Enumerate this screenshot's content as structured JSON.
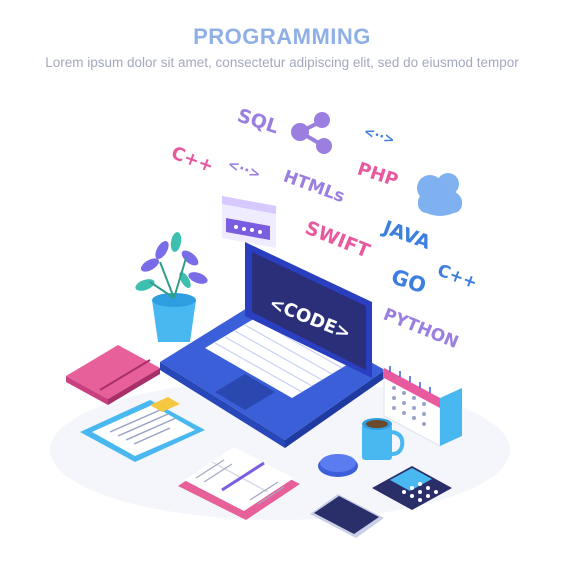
{
  "header": {
    "title": "PROGRAMMING",
    "subtitle": "Lorem ipsum dolor sit amet, consectetur   adipiscing elit, sed do eiusmod tempor"
  },
  "screen": {
    "code_label": "<CODE>"
  },
  "tags": {
    "sql": "SQL",
    "cpp_left": "C++",
    "arrows_left": "<··>",
    "arrows_right": "<··>",
    "html": "HTMLs",
    "php": "PHP",
    "swift": "SWIFT",
    "java": "JAVA",
    "go": "GO",
    "cpp_right": "C++",
    "python": "PYTHON"
  },
  "colors": {
    "title": "#8fb0e6",
    "subtitle": "#a4a8be",
    "tag_purple": "#9b7fe0",
    "tag_pink": "#e85aa0",
    "tag_blue": "#3d7fe0",
    "laptop_body": "#3a5fd8",
    "screen_dark": "#2b2f7a",
    "cloud": "#7fb0f0"
  }
}
